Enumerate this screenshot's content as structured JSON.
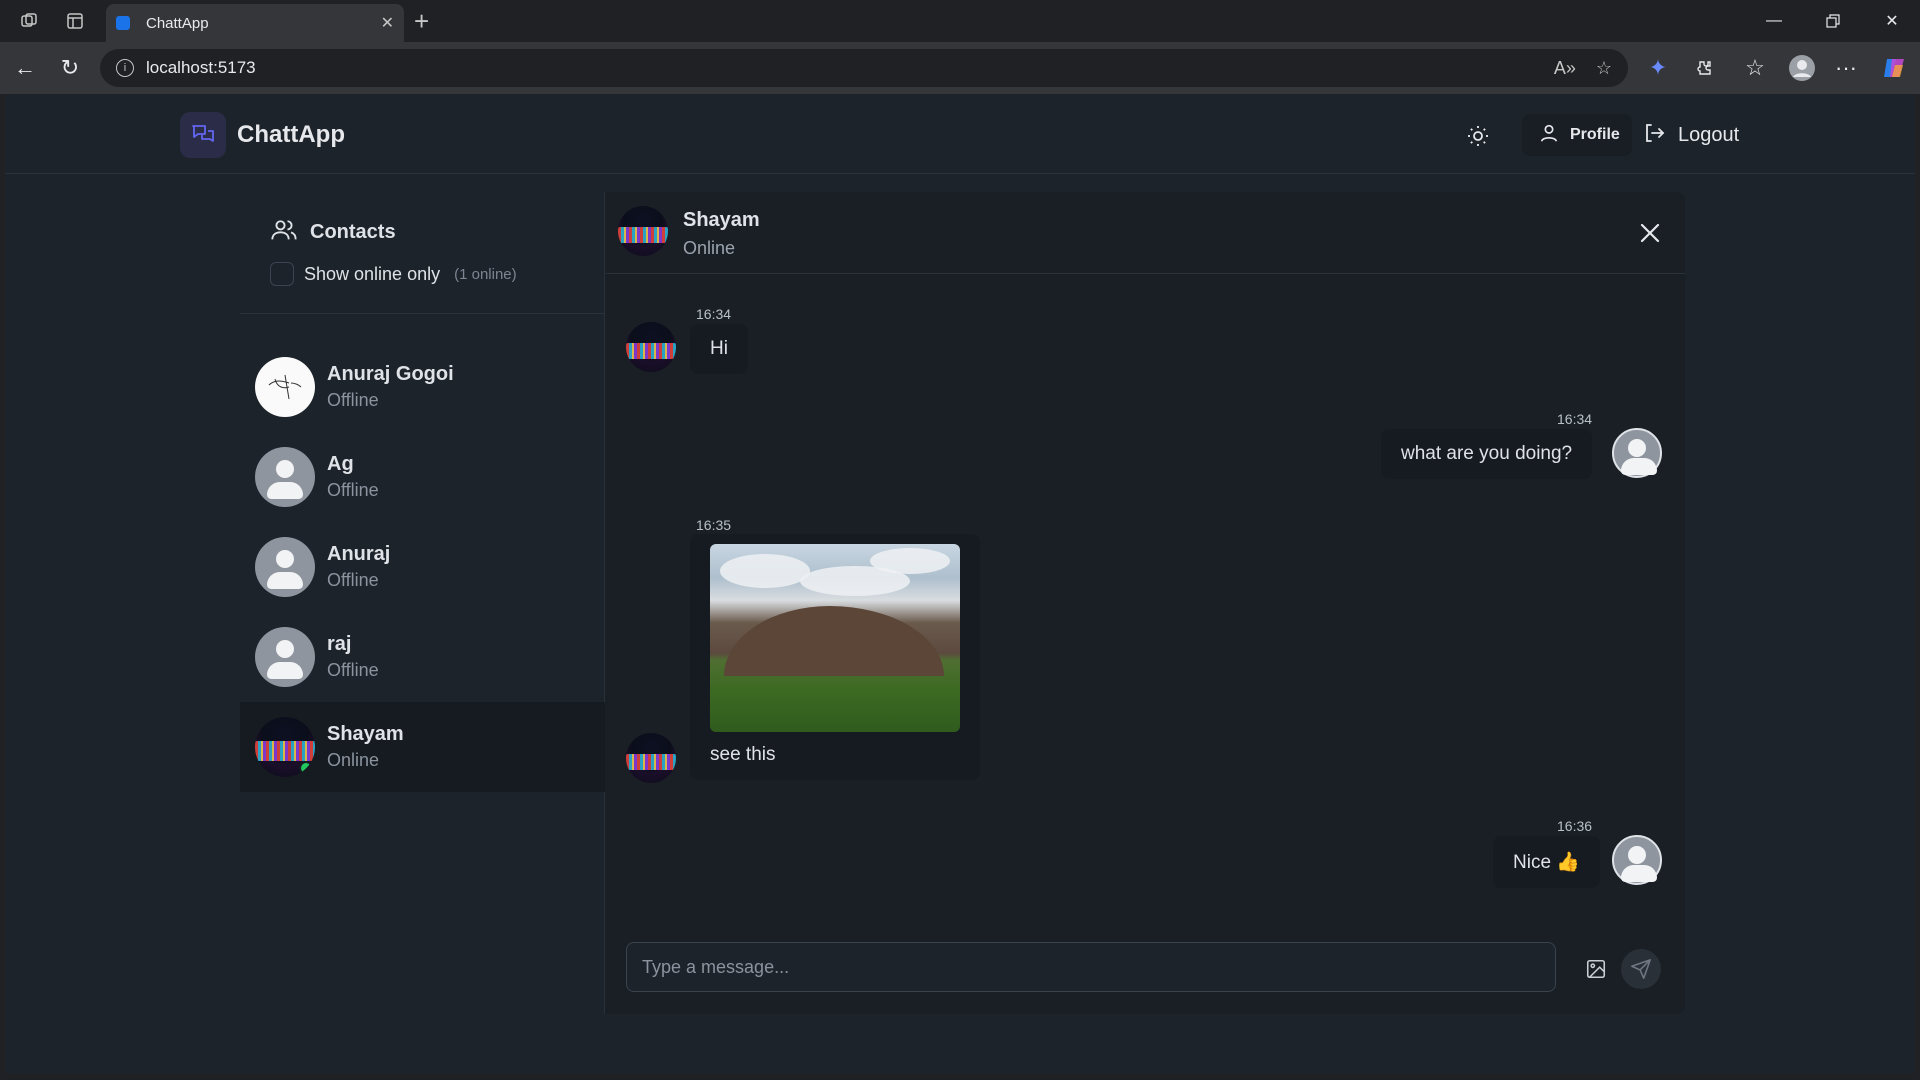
{
  "browser": {
    "tab_title": "ChattApp",
    "url": "localhost:5173"
  },
  "app": {
    "title": "ChattApp",
    "profile_label": "Profile",
    "logout_label": "Logout"
  },
  "sidebar": {
    "title": "Contacts",
    "toggle_label": "Show online only",
    "online_count": "(1 online)",
    "contacts": [
      {
        "name": "Anuraj Gogoi",
        "status": "Offline"
      },
      {
        "name": "Ag",
        "status": "Offline"
      },
      {
        "name": "Anuraj",
        "status": "Offline"
      },
      {
        "name": "raj",
        "status": "Offline"
      },
      {
        "name": "Shayam",
        "status": "Online"
      }
    ]
  },
  "chat": {
    "name": "Shayam",
    "status": "Online",
    "messages": [
      {
        "time": "16:34",
        "text": "Hi",
        "from": "them"
      },
      {
        "time": "16:34",
        "text": "what are you doing?",
        "from": "me"
      },
      {
        "time": "16:35",
        "text": "see this",
        "from": "them",
        "has_image": true
      },
      {
        "time": "16:36",
        "text": "Nice 👍",
        "from": "me"
      }
    ],
    "input_placeholder": "Type a message..."
  },
  "colors": {
    "accent": "#6366f1",
    "online": "#22c55e",
    "background": "#1d232a"
  }
}
